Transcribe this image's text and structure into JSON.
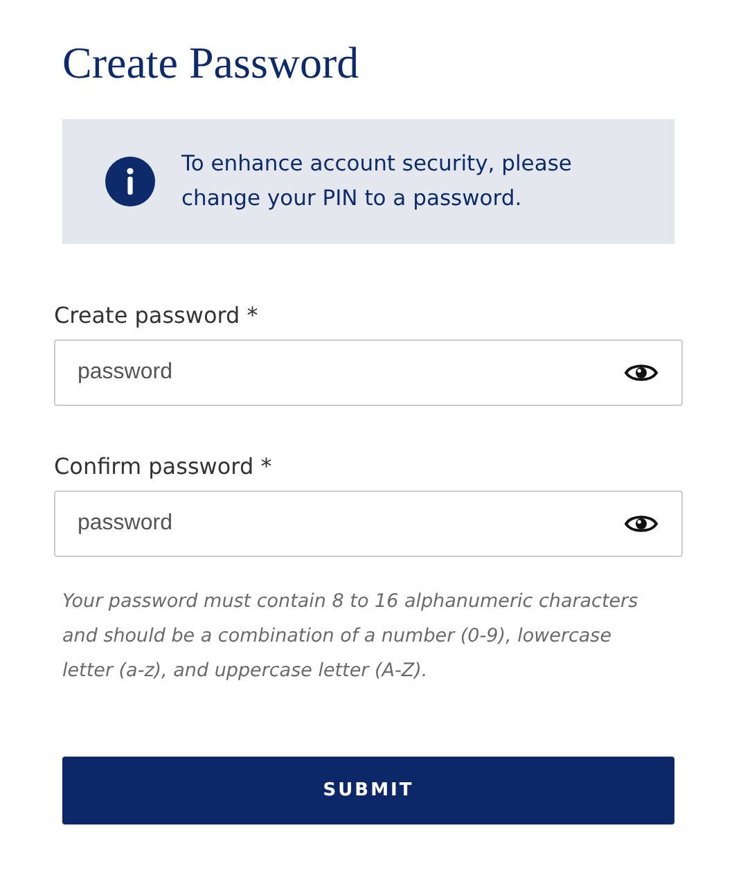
{
  "title": "Create Password",
  "notice": {
    "text": "To enhance account security, please change your PIN to a password."
  },
  "fields": [
    {
      "label": "Create password *",
      "placeholder": "password"
    },
    {
      "label": "Confirm password *",
      "placeholder": "password"
    }
  ],
  "hint": "Your password must contain 8 to 16 alphanumeric characters and should be a combination of a number (0-9), lowercase letter (a-z), and uppercase letter (A-Z).",
  "submit": "SUBMIT"
}
